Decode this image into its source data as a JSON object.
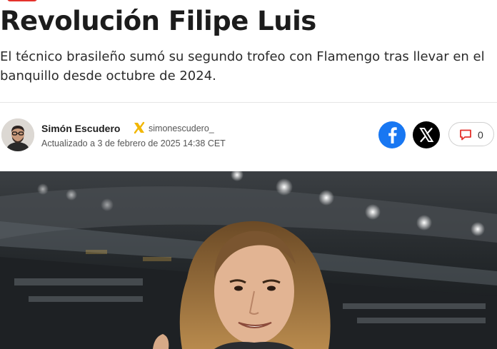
{
  "article": {
    "headline": "Revolución Filipe Luis",
    "subtitle": "El técnico brasileño sumó su segundo trofeo con Flamengo tras llevar en el banquillo desde octubre de 2024."
  },
  "byline": {
    "author_name": "Simón Escudero",
    "social_icon": "x-icon",
    "handle": "simonescudero_",
    "updated": "Actualizado a 3 de febrero de 2025 14:38 CET"
  },
  "share": {
    "facebook_icon": "facebook-icon",
    "x_icon": "x-icon",
    "comment_icon": "comment-icon",
    "comment_count": "0"
  },
  "colors": {
    "brand_red": "#e4312b",
    "facebook_blue": "#1877f2",
    "x_badge_gold": "#f2b705"
  }
}
